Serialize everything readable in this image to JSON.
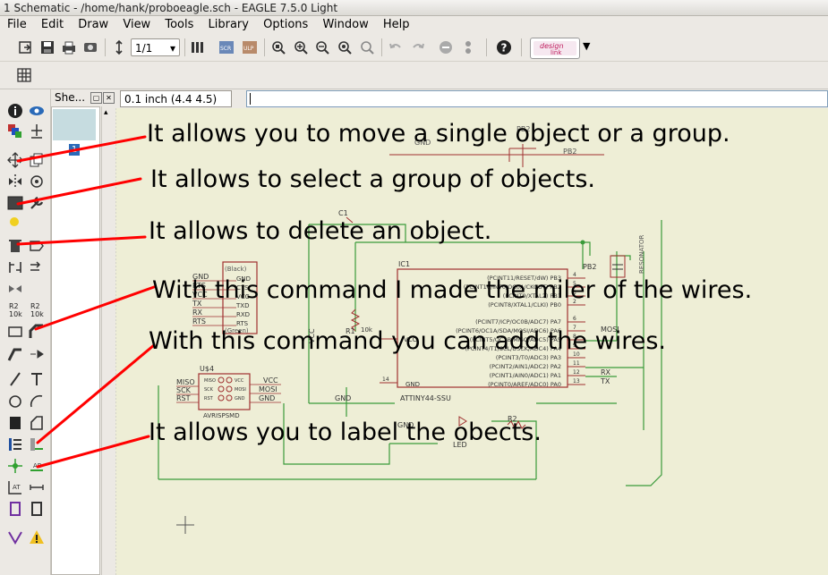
{
  "window": {
    "title": "1 Schematic - /home/hank/proboeagle.sch - EAGLE 7.5.0 Light"
  },
  "menu": [
    "File",
    "Edit",
    "Draw",
    "View",
    "Tools",
    "Library",
    "Options",
    "Window",
    "Help"
  ],
  "toolbar": {
    "sheet_select": "1/1",
    "brand": "design link"
  },
  "sheets_panel": {
    "title": "She...",
    "close": "✕",
    "sheet_number": "1"
  },
  "command": {
    "grid_readout": "0.1 inch (4.4 4.5)",
    "input_value": ""
  },
  "annotations": [
    "It allows you to move a single object or a group.",
    "It allows to select a group of objects.",
    "It allows to delete an object.",
    "With this command I made the miler of the wires.",
    "With this command you can add the wires.",
    "It allows you to label the obects."
  ],
  "schematic": {
    "top_labels": {
      "gnd": "GND",
      "pb2": "PB2",
      "part": "PB2"
    },
    "c1": "C1",
    "ic1": "IC1",
    "ic_name": "ATTINY44-SSU",
    "ic_pins_right": [
      "(PCINT11/RESET/dW) PB3",
      "(PCINT10/INT0/OC0A/CKOUT) PB2",
      "(PCINT9/XTAL2) PB1",
      "(PCINT8/XTAL1/CLKI) PB0",
      "(PCINT7/ICP/OC0B/ADC7) PA7",
      "(PCINT6/OC1A/SDA/MOSI/ADC6) PA6",
      "(PCINT5/OC1B/MISO/ADC5) PA5",
      "(PCINT4/T1/SCL/USCK/ADC4) PA4",
      "(PCINT3/T0/ADC3) PA3",
      "(PCINT2/AIN1/ADC2) PA2",
      "(PCINT1/AIN0/ADC1) PA1",
      "(PCINT0/AREF/ADC0) PA0"
    ],
    "ic_pin_numbers": [
      "4",
      "5",
      "3",
      "2",
      "6",
      "7",
      "8",
      "9",
      "10",
      "11",
      "12",
      "13"
    ],
    "ic_vcc": "VCC",
    "ic_gnd": "GND",
    "ic_gnd_pin": "14",
    "ftdi": {
      "top": "(Black)",
      "bottom": "(Green)",
      "pins": [
        "GND",
        "CTS",
        "VCC",
        "TXD",
        "RXD",
        "RTS"
      ],
      "nets": [
        "GND",
        "RTS",
        "VCC",
        "TX",
        "RX",
        "RTS"
      ]
    },
    "r1": "R1",
    "r1_value": "10k",
    "vcc_left": "VCC",
    "gnd_mid": "GND",
    "resonator": "RESONATOR",
    "pb2_right": "PB2",
    "nets_right": {
      "mosi": "MOSI",
      "rx": "RX",
      "tx": "TX"
    },
    "usb": {
      "name": "U$4",
      "part": "AVRISPSMD",
      "left": [
        "MISO",
        "SCK",
        "RST"
      ],
      "right": [
        "VCC",
        "MOSI",
        "GND"
      ],
      "pins_l": [
        "MISO",
        "SCK",
        "RST"
      ],
      "pins_r": [
        "VCC",
        "MOSI",
        "GND"
      ]
    },
    "led": "LED",
    "r2": "R2",
    "gnd_bottom": "GND"
  },
  "colors": {
    "canvas": "#eeeed6",
    "wire": "#3a9a3a",
    "part": "#a03030",
    "annotation_line": "#ff0000"
  }
}
